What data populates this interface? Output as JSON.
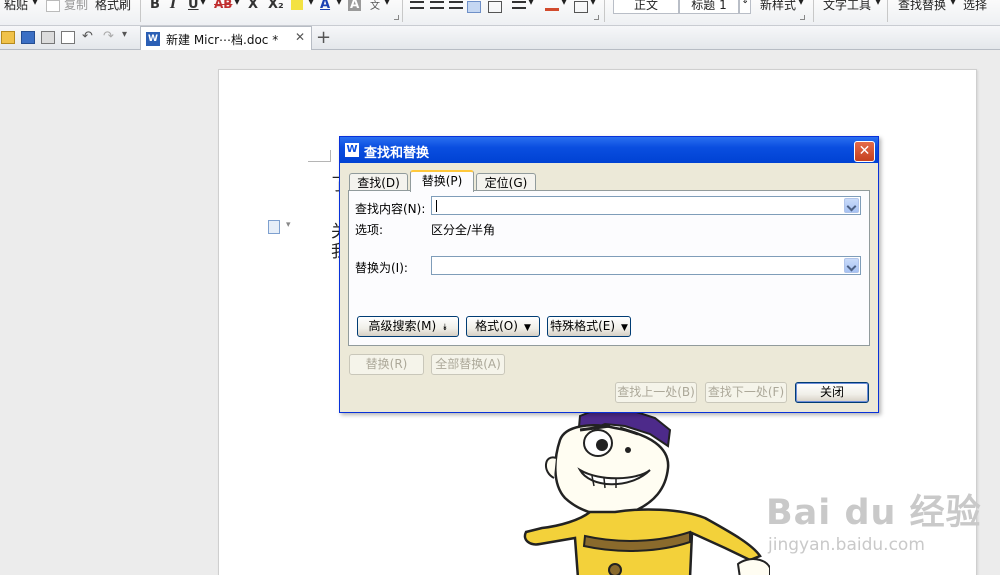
{
  "ribbon": {
    "paste": "粘贴",
    "copy": "复制",
    "format_painter": "格式刷",
    "bold": "B",
    "italic": "I",
    "underline": "U",
    "strike": "AB",
    "superscript": "X",
    "subscript": "X₂",
    "font_color": "A",
    "char_shading": "A",
    "phonetic": "文",
    "style_normal": "正文",
    "style_heading1": "标题 1",
    "new_style": "新样式",
    "text_tools": "文字工具",
    "find_replace": "查找替换",
    "select": "选择"
  },
  "tabbar": {
    "doc_tab_label": "新建 Micr⋯档.doc *",
    "word_icon_letter": "W",
    "close_glyph": "✕",
    "new_tab_glyph": "+"
  },
  "document": {
    "line1_char": "了",
    "line2_char": "关",
    "line3_char": "我"
  },
  "watermark": {
    "logo": "Bai du 经验",
    "url": "jingyan.baidu.com"
  },
  "dialog": {
    "title": "查找和替换",
    "title_icon_letter": "W",
    "close_glyph": "✕",
    "tabs": [
      {
        "label": "查找(D)",
        "active": false
      },
      {
        "label": "替换(P)",
        "active": true
      },
      {
        "label": "定位(G)",
        "active": false
      }
    ],
    "find_label": "查找内容(N):",
    "find_value": "",
    "options_label": "选项:",
    "options_value": "区分全/半角",
    "replace_label": "替换为(I):",
    "replace_value": "",
    "advanced_button": "高级搜索(M)",
    "format_button": "格式(O)",
    "special_button": "特殊格式(E)",
    "replace_button": "替换(R)",
    "replace_all_button": "全部替换(A)",
    "find_prev_button": "查找上一处(B)",
    "find_next_button": "查找下一处(F)",
    "close_button": "关闭"
  }
}
